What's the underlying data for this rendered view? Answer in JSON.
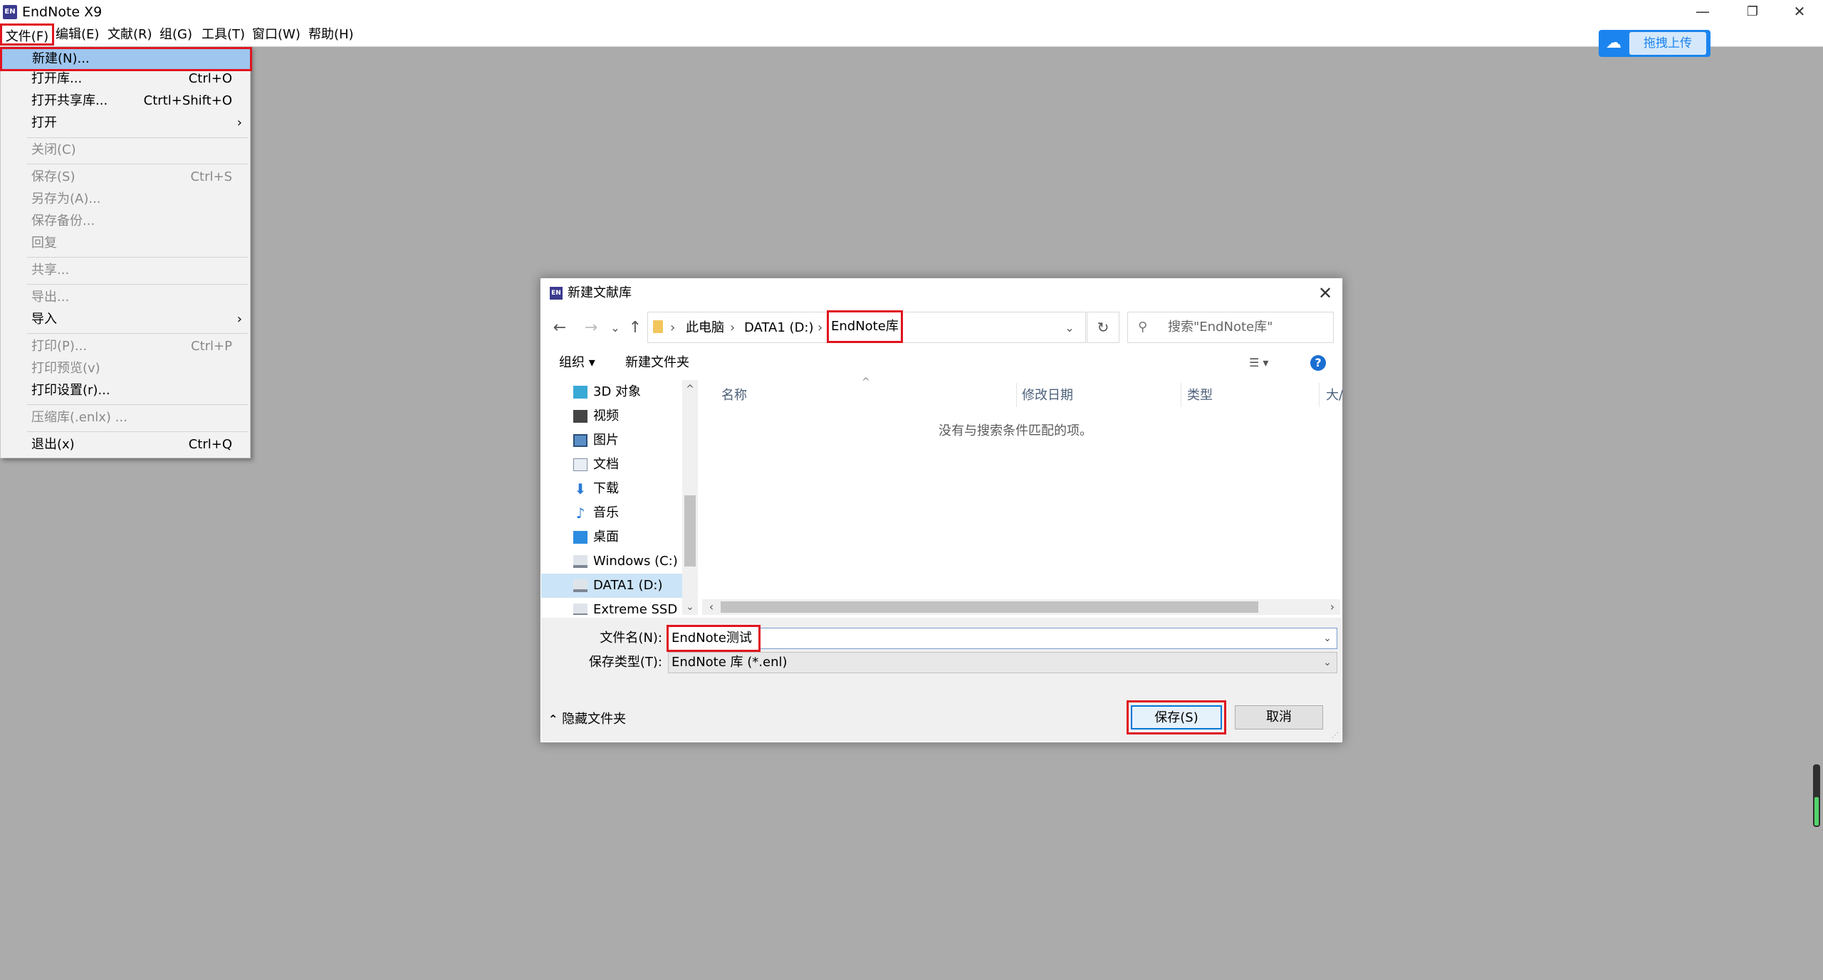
{
  "app": {
    "title": "EndNote X9",
    "logo_text": "EN"
  },
  "menubar": {
    "items": [
      "文件(F)",
      "编辑(E)",
      "文献(R)",
      "组(G)",
      "工具(T)",
      "窗口(W)",
      "帮助(H)"
    ]
  },
  "upload_widget": {
    "label": "拖拽上传"
  },
  "file_menu": {
    "items": [
      {
        "label": "新建(N)...",
        "shortcut": "",
        "enabled": true,
        "selected": true
      },
      {
        "label": "打开库...",
        "shortcut": "Ctrl+O",
        "enabled": true
      },
      {
        "label": "打开共享库...",
        "shortcut": "Ctrtl+Shift+O",
        "enabled": true
      },
      {
        "label": "打开",
        "shortcut": "",
        "enabled": true,
        "submenu": true
      },
      {
        "label": "关闭(C)",
        "shortcut": "",
        "enabled": false
      },
      {
        "label": "保存(S)",
        "shortcut": "Ctrl+S",
        "enabled": false
      },
      {
        "label": "另存为(A)...",
        "shortcut": "",
        "enabled": false
      },
      {
        "label": "保存备份...",
        "shortcut": "",
        "enabled": false
      },
      {
        "label": "回复",
        "shortcut": "",
        "enabled": false
      },
      {
        "label": "共享...",
        "shortcut": "",
        "enabled": false
      },
      {
        "label": "导出...",
        "shortcut": "",
        "enabled": false
      },
      {
        "label": "导入",
        "shortcut": "",
        "enabled": true,
        "submenu": true
      },
      {
        "label": "打印(P)...",
        "shortcut": "Ctrl+P",
        "enabled": false
      },
      {
        "label": "打印预览(v)",
        "shortcut": "",
        "enabled": false
      },
      {
        "label": "打印设置(r)...",
        "shortcut": "",
        "enabled": true
      },
      {
        "label": "压缩库(.enlx) ...",
        "shortcut": "",
        "enabled": false
      },
      {
        "label": "退出(x)",
        "shortcut": "Ctrl+Q",
        "enabled": true
      }
    ],
    "submenu_arrow": "›"
  },
  "dialog": {
    "icon_text": "EN",
    "title": "新建文献库",
    "close_glyph": "✕",
    "nav": {
      "back": "←",
      "forward": "→",
      "recent": "⌄",
      "up": "↑"
    },
    "breadcrumb": [
      "此电脑",
      "DATA1 (D:)",
      "EndNote库"
    ],
    "breadcrumb_sep": "›",
    "addr_dropdown": "⌄",
    "refresh_glyph": "↻",
    "search_placeholder": "搜索\"EndNote库\"",
    "search_glyph": "⚲",
    "toolbar": {
      "organize": "组织 ▾",
      "new_folder": "新建文件夹",
      "view_glyph": "☰ ▾",
      "help_glyph": "?"
    },
    "tree": [
      {
        "label": "3D 对象",
        "icon": "3d-objects-icon"
      },
      {
        "label": "视频",
        "icon": "video-icon"
      },
      {
        "label": "图片",
        "icon": "pictures-icon"
      },
      {
        "label": "文档",
        "icon": "documents-icon"
      },
      {
        "label": "下载",
        "icon": "downloads-icon"
      },
      {
        "label": "音乐",
        "icon": "music-icon"
      },
      {
        "label": "桌面",
        "icon": "desktop-icon"
      },
      {
        "label": "Windows (C:)",
        "icon": "drive-icon"
      },
      {
        "label": "DATA1 (D:)",
        "icon": "drive-icon",
        "selected": true
      },
      {
        "label": "Extreme SSD (F",
        "icon": "drive-icon"
      }
    ],
    "columns": [
      "名称",
      "修改日期",
      "类型",
      "大/"
    ],
    "sort_glyph": "^",
    "empty_message": "没有与搜索条件匹配的项。",
    "filename_label": "文件名(N):",
    "filename_value": "EndNote测试",
    "filetype_label": "保存类型(T):",
    "filetype_value": "EndNote 库 (*.enl)",
    "hide_folders": "隐藏文件夹",
    "save_button": "保存(S)",
    "cancel_button": "取消",
    "scroll": {
      "up": "^",
      "down": "⌄",
      "left": "‹",
      "right": "›"
    }
  },
  "colors": {
    "highlight_box": "#e0141e",
    "menu_selected": "#9ec6ef",
    "background": "#ababab"
  }
}
